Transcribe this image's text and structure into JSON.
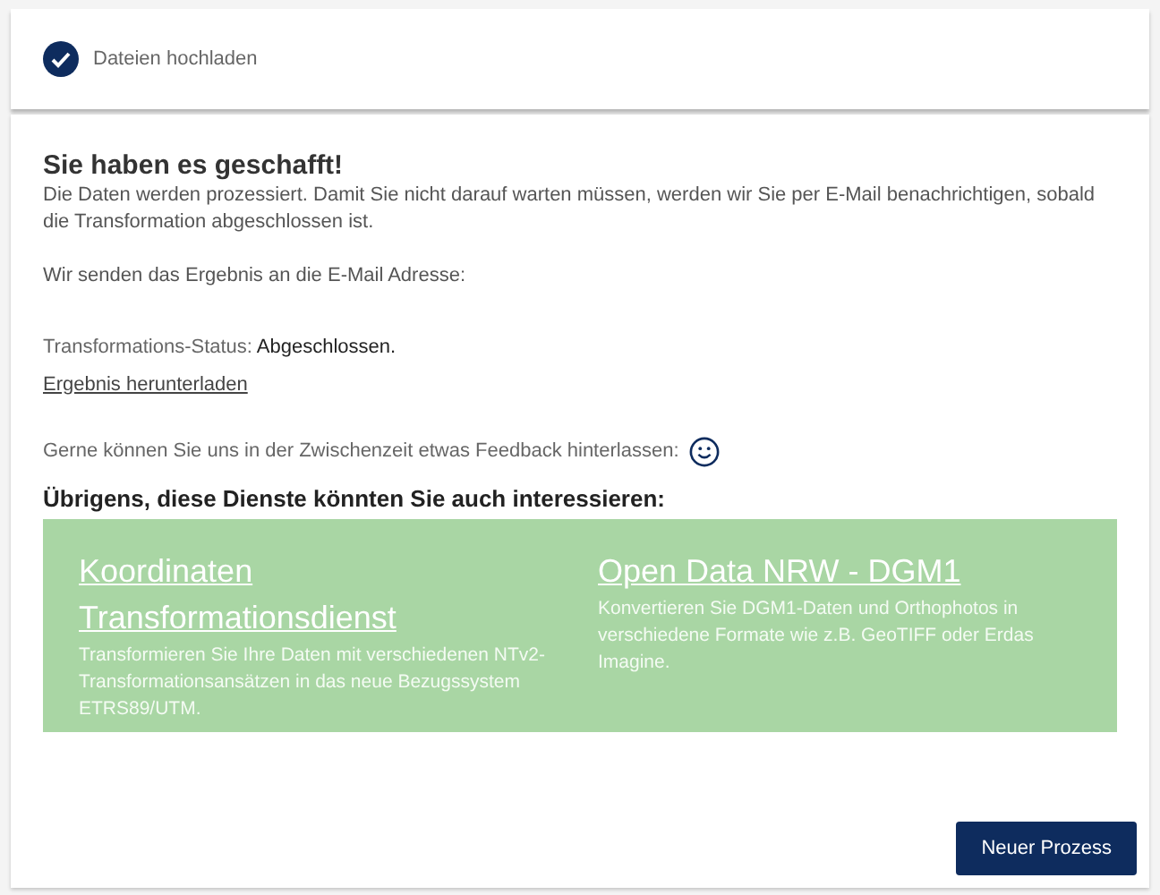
{
  "step": {
    "label": "Dateien hochladen",
    "completed": true
  },
  "heading": "Sie haben es geschafft!",
  "intro": "Die Daten werden prozessiert. Damit Sie nicht darauf warten müssen, werden wir Sie per E-Mail benachrichtigen, sobald die Transformation abgeschlossen ist.",
  "email_line": "Wir senden das Ergebnis an die E-Mail Adresse:",
  "status": {
    "label": "Transformations-Status:",
    "value": "Abgeschlossen."
  },
  "download_link": "Ergebnis herunterladen",
  "feedback": "Gerne können Sie uns in der Zwischenzeit etwas Feedback hinterlassen:",
  "services_heading": "Übrigens, diese Dienste könnten Sie auch interessieren:",
  "services": [
    {
      "title": "Koordinaten Transformationsdienst",
      "description": "Transformieren Sie Ihre Daten mit verschiedenen NTv2-Transformationsansätzen in das neue Bezugssystem ETRS89/UTM."
    },
    {
      "title": "Open Data NRW - DGM1",
      "description": "Konvertieren Sie DGM1-Daten und Orthophotos in verschiedene Formate wie z.B. GeoTIFF oder Erdas Imagine."
    }
  ],
  "button": "Neuer Prozess"
}
